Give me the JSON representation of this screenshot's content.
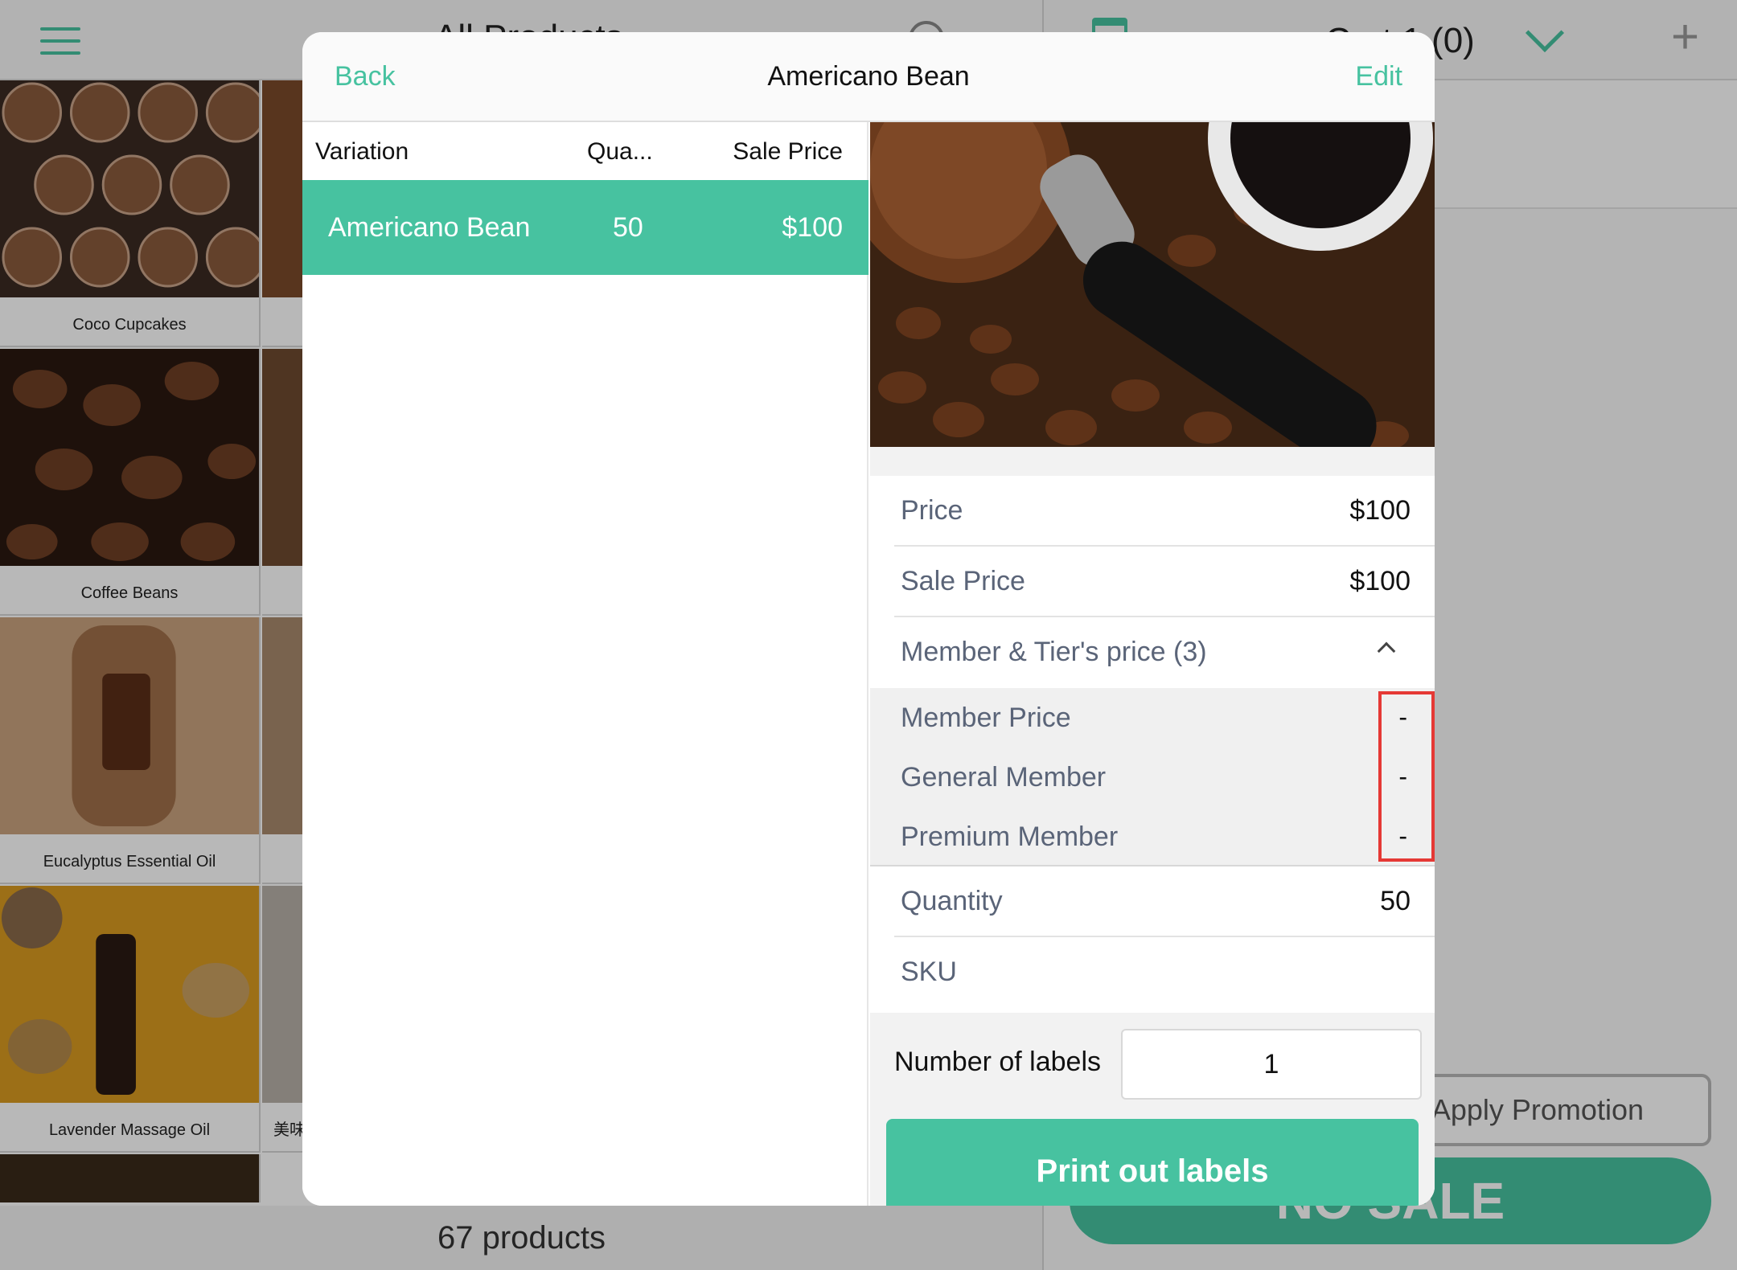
{
  "background": {
    "header_title": "All Products",
    "products": [
      {
        "name": "Coco Cupcakes"
      },
      {
        "name": "Coffee Beans"
      },
      {
        "name": "Eucalyptus Essential Oil"
      },
      {
        "name": "Lavender Massage Oil"
      }
    ],
    "partial_label": "美味 愛！回",
    "product_count": "67 products",
    "cart_title": "Cart 1 (0)",
    "apply_promotion": "Apply Promotion",
    "no_sale": "NO SALE"
  },
  "modal": {
    "back_label": "Back",
    "title": "Americano Bean",
    "edit_label": "Edit",
    "table": {
      "columns": [
        "Variation",
        "Qua...",
        "Sale Price"
      ],
      "rows": [
        {
          "variation": "Americano Bean",
          "quantity": "50",
          "sale_price": "$100"
        }
      ]
    },
    "details": {
      "price_label": "Price",
      "price_value": "$100",
      "sale_price_label": "Sale Price",
      "sale_price_value": "$100",
      "member_tier_label": "Member & Tier's price (3)",
      "member_prices": [
        {
          "label": "Member Price",
          "value": "-"
        },
        {
          "label": "General Member",
          "value": "-"
        },
        {
          "label": "Premium Member",
          "value": "-"
        }
      ],
      "quantity_label": "Quantity",
      "quantity_value": "50",
      "sku_label": "SKU"
    },
    "labels": {
      "number_label": "Number of labels",
      "number_value": "1",
      "print_button": "Print out labels"
    }
  },
  "colors": {
    "accent": "#47c2a0",
    "highlight": "#e53935"
  }
}
